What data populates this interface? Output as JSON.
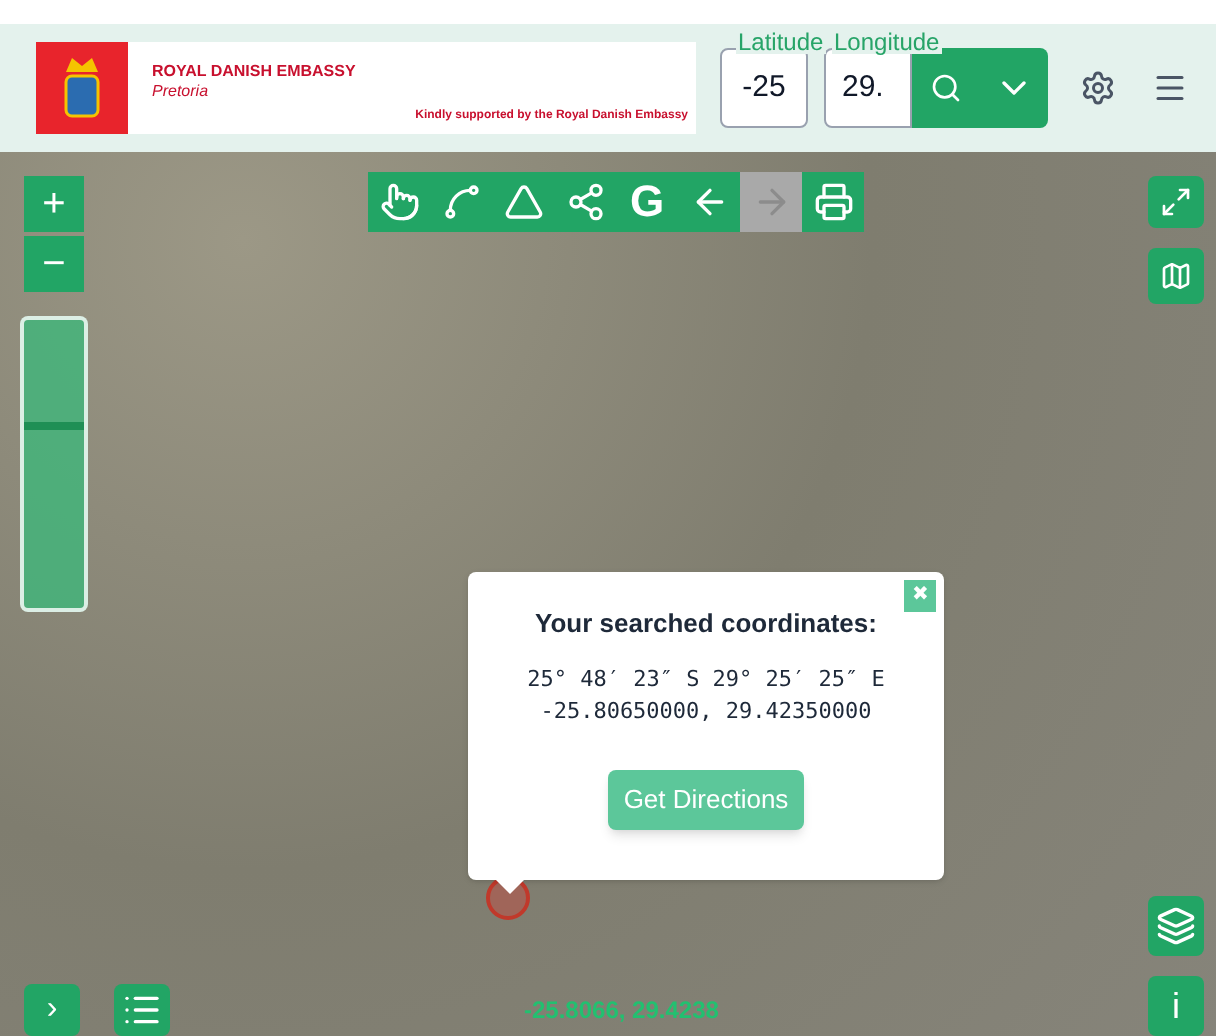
{
  "header": {
    "org_name": "ROYAL DANISH EMBASSY",
    "city": "Pretoria",
    "support_note": "Kindly supported by the Royal Danish Embassy",
    "latitude": {
      "label": "Latitude",
      "value": "-25"
    },
    "longitude": {
      "label": "Longitude",
      "value": "29."
    }
  },
  "toolbar": [
    {
      "kind": "hand",
      "disabled": false
    },
    {
      "kind": "measure-line",
      "disabled": false
    },
    {
      "kind": "measure-area",
      "disabled": false
    },
    {
      "kind": "network",
      "disabled": false
    },
    {
      "kind": "letter",
      "text": "G",
      "disabled": false
    },
    {
      "kind": "back",
      "disabled": false
    },
    {
      "kind": "forward",
      "disabled": true
    },
    {
      "kind": "print",
      "disabled": false
    }
  ],
  "zoom": {
    "in": "+",
    "out": "−",
    "level": 0.62
  },
  "popup": {
    "title": "Your searched coordinates:",
    "dms": "25° 48′ 23″ S 29° 25′ 25″ E",
    "decimal": "-25.80650000, 29.42350000",
    "button": "Get Directions",
    "close": "✖"
  },
  "status": {
    "coordinates": "-25.8066, 29.4238",
    "expand_toggle": "›",
    "info": "i"
  }
}
